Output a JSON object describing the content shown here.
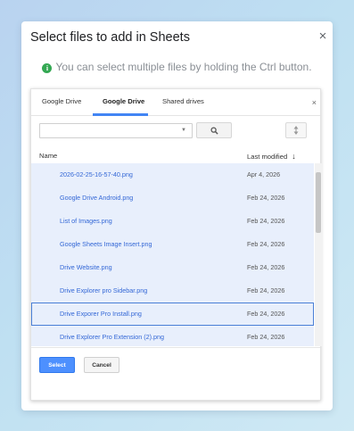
{
  "dialog": {
    "title": "Select files to add in Sheets",
    "close": "×",
    "hint": "You can select multiple files by holding the Ctrl button.",
    "info_glyph": "i"
  },
  "picker": {
    "tabs": [
      {
        "label": "Google Drive",
        "active": false
      },
      {
        "label": "Google Drive",
        "active": true
      },
      {
        "label": "Shared drives",
        "active": false
      }
    ],
    "close": "×",
    "search": {
      "value": "",
      "placeholder": ""
    },
    "columns": {
      "name": "Name",
      "modified": "Last modified",
      "sort_arrow": "↓"
    },
    "files": [
      {
        "name": "2026-02-25-16-57-40.png",
        "date": "Apr 4, 2026"
      },
      {
        "name": "Google Drive Android.png",
        "date": "Feb 24, 2026"
      },
      {
        "name": "List of Images.png",
        "date": "Feb 24, 2026"
      },
      {
        "name": "Google Sheets Image Insert.png",
        "date": "Feb 24, 2026"
      },
      {
        "name": "Drive Website.png",
        "date": "Feb 24, 2026"
      },
      {
        "name": "Drive Explorer pro Sidebar.png",
        "date": "Feb 24, 2026"
      },
      {
        "name": "Drive Exporer Pro Install.png",
        "date": "Feb 24, 2026"
      },
      {
        "name": "Drive Explorer Pro Extension (2).png",
        "date": "Feb 24, 2026"
      }
    ],
    "focused_index": 6,
    "buttons": {
      "select": "Select",
      "cancel": "Cancel"
    }
  },
  "colors": {
    "accent": "#4285f4",
    "select_button": "#4d90fe",
    "row_selected_bg": "#e8effc",
    "link_text": "#3367d6",
    "info_icon": "#34a853"
  }
}
